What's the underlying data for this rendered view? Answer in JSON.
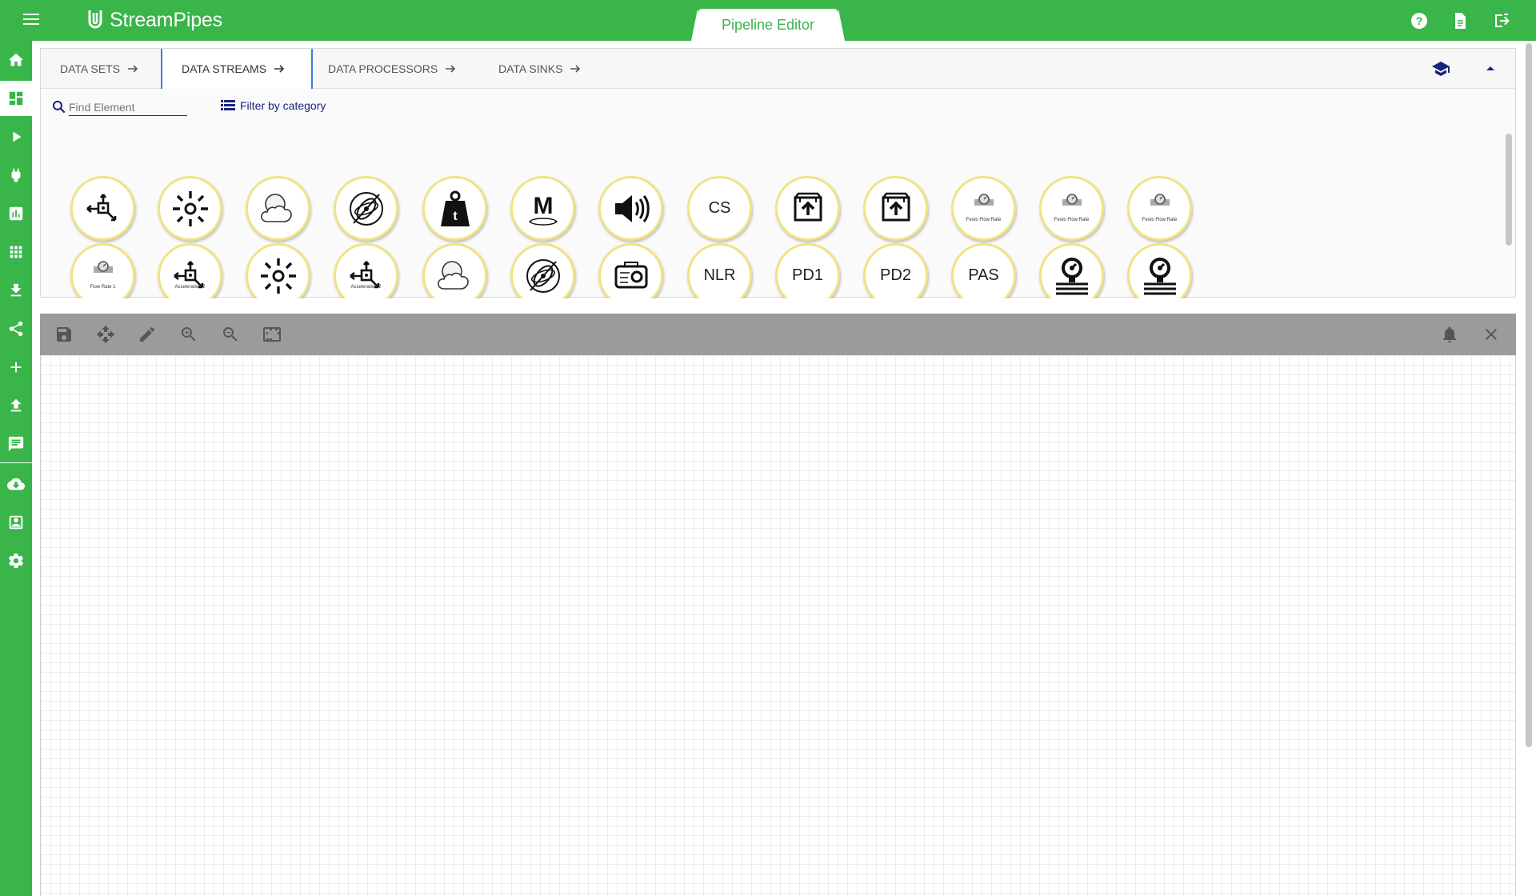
{
  "app": {
    "brand": "StreamPipes",
    "editor_tab": "Pipeline Editor"
  },
  "colors": {
    "brand_green": "#39b54a",
    "element_border": "#f1e384",
    "active_tab": "#3d7ddb"
  },
  "topbar_icons": [
    "help-icon",
    "docs-icon",
    "logout-icon"
  ],
  "sidebar_icons": [
    "home-icon",
    "dashboard-icon",
    "play-icon",
    "plug-icon",
    "chart-icon",
    "apps-icon",
    "download-icon",
    "share-icon",
    "add-icon",
    "upload-icon",
    "notifications-icon",
    "cloud-download-icon",
    "contact-icon",
    "settings-icon"
  ],
  "tabs": [
    {
      "label": "DATA SETS"
    },
    {
      "label": "DATA STREAMS"
    },
    {
      "label": "DATA PROCESSORS"
    },
    {
      "label": "DATA SINKS"
    }
  ],
  "search": {
    "placeholder": "Find Element",
    "filter_label": "Filter by category"
  },
  "elements_row1": [
    {
      "icon": "acceleration-icon"
    },
    {
      "icon": "sun-icon"
    },
    {
      "icon": "cloud-icon"
    },
    {
      "icon": "gyroscope-icon"
    },
    {
      "icon": "weight-icon"
    },
    {
      "icon": "magnet-icon"
    },
    {
      "icon": "speaker-icon"
    },
    {
      "text": "CS"
    },
    {
      "icon": "upload-box-icon"
    },
    {
      "icon": "upload-box-icon"
    },
    {
      "icon": "flow-rate-icon",
      "mini": "Festo Flow Rate"
    },
    {
      "icon": "flow-rate-icon",
      "mini": "Festo Flow Rate"
    },
    {
      "icon": "flow-rate-icon",
      "mini": "Festo Flow Rate"
    }
  ],
  "elements_row2": [
    {
      "icon": "flow-rate-icon",
      "mini": "Flow Rate 1"
    },
    {
      "icon": "acceleration-icon",
      "mini": "Acceleration 2"
    },
    {
      "icon": "sun-icon"
    },
    {
      "icon": "acceleration-icon",
      "mini": "Acceleration 2"
    },
    {
      "icon": "cloud-icon"
    },
    {
      "icon": "gyroscope-icon"
    },
    {
      "icon": "camera-icon"
    },
    {
      "text": "NLR"
    },
    {
      "text": "PD1"
    },
    {
      "text": "PD2"
    },
    {
      "text": "PAS"
    },
    {
      "icon": "pressure-gauge-icon"
    },
    {
      "icon": "pressure-gauge-icon"
    }
  ],
  "canvas_tools": [
    "save-icon",
    "move-icon",
    "edit-icon",
    "zoom-in-icon",
    "zoom-out-icon",
    "fit-icon"
  ],
  "canvas_right_tools": [
    "notification-bell-icon",
    "close-icon"
  ]
}
